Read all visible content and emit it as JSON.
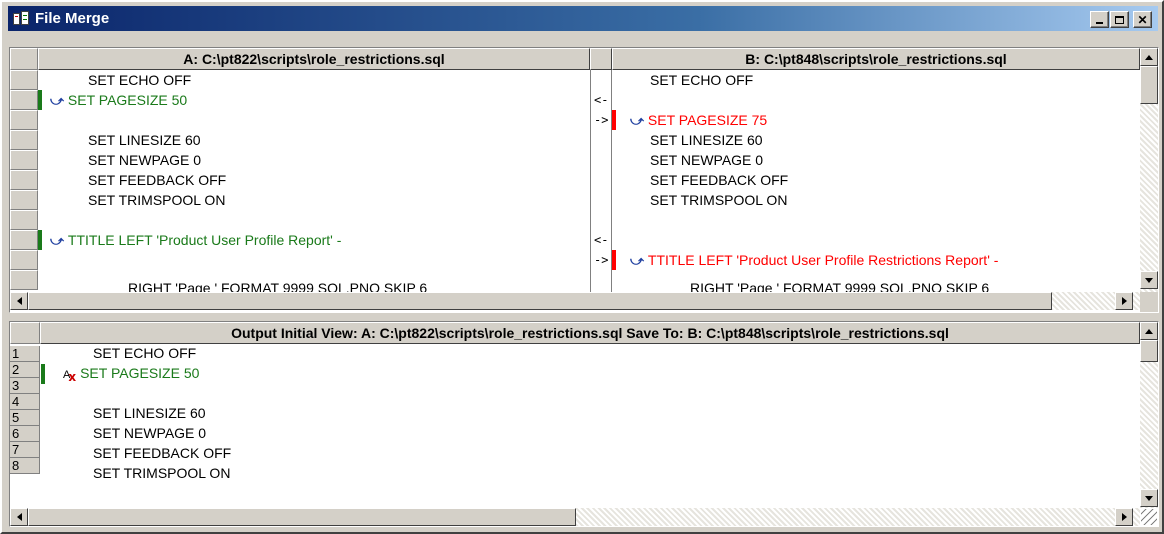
{
  "window": {
    "title": "File Merge"
  },
  "pane_a": {
    "header": "A: C:\\pt822\\scripts\\role_restrictions.sql",
    "lines": [
      {
        "text": "SET ECHO OFF",
        "state": "same"
      },
      {
        "text": "SET PAGESIZE 50",
        "state": "changed"
      },
      {
        "text": "",
        "state": "blank"
      },
      {
        "text": "SET LINESIZE 60",
        "state": "same"
      },
      {
        "text": "SET NEWPAGE 0",
        "state": "same"
      },
      {
        "text": "SET FEEDBACK OFF",
        "state": "same"
      },
      {
        "text": "SET TRIMSPOOL ON",
        "state": "same"
      },
      {
        "text": "",
        "state": "blank"
      },
      {
        "text": "TTITLE LEFT 'Product User Profile Report' -",
        "state": "changed"
      },
      {
        "text": "",
        "state": "blank"
      },
      {
        "text": "RIGHT 'Page ' FORMAT 9999 SQL.PNO SKIP 6",
        "state": "cut"
      }
    ]
  },
  "pane_b": {
    "header": "B: C:\\pt848\\scripts\\role_restrictions.sql",
    "lines": [
      {
        "text": "SET ECHO OFF",
        "state": "same"
      },
      {
        "text": "",
        "state": "blank"
      },
      {
        "text": "SET PAGESIZE 75",
        "state": "changed"
      },
      {
        "text": "SET LINESIZE 60",
        "state": "same"
      },
      {
        "text": "SET NEWPAGE 0",
        "state": "same"
      },
      {
        "text": "SET FEEDBACK OFF",
        "state": "same"
      },
      {
        "text": "SET TRIMSPOOL ON",
        "state": "same"
      },
      {
        "text": "",
        "state": "blank"
      },
      {
        "text": "",
        "state": "blank"
      },
      {
        "text": "TTITLE LEFT 'Product User Profile Restrictions Report' -",
        "state": "changed"
      },
      {
        "text": "RIGHT 'Page ' FORMAT 9999 SQL.PNO SKIP 6",
        "state": "cut"
      }
    ]
  },
  "merge_arrows": {
    "left": "<-",
    "right": "->"
  },
  "output": {
    "header": "Output    Initial View: A: C:\\pt822\\scripts\\role_restrictions.sql    Save To: B: C:\\pt848\\scripts\\role_restrictions.sql",
    "line_numbers": [
      "1",
      "2",
      "3",
      "4",
      "5",
      "6",
      "7",
      "8"
    ],
    "lines": [
      {
        "text": "SET ECHO OFF",
        "state": "same"
      },
      {
        "text": "SET PAGESIZE 50",
        "state": "changed"
      },
      {
        "text": "",
        "state": "blank"
      },
      {
        "text": "SET LINESIZE 60",
        "state": "same"
      },
      {
        "text": "SET NEWPAGE 0",
        "state": "same"
      },
      {
        "text": "SET FEEDBACK OFF",
        "state": "same"
      },
      {
        "text": "SET TRIMSPOOL ON",
        "state": "same"
      },
      {
        "text": "",
        "state": "blank"
      }
    ]
  },
  "icons": {
    "title": "file-merge-app-icon",
    "change": "curved-arrow-icon",
    "reject": "text-x-icon"
  },
  "colors": {
    "green": "#1a7a1a",
    "red": "#ff0000",
    "title_start": "#0a246a",
    "title_end": "#a6caf0"
  }
}
